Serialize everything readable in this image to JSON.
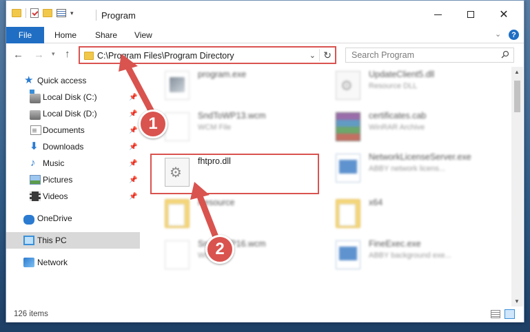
{
  "window": {
    "title": "Program"
  },
  "ribbon": {
    "tabs": [
      "File",
      "Home",
      "Share",
      "View"
    ]
  },
  "navbar": {
    "address": "C:\\Program Files\\Program Directory",
    "search_placeholder": "Search Program"
  },
  "sidebar": {
    "items": [
      {
        "label": "Quick access",
        "icon": "star-icon"
      },
      {
        "label": "Local Disk (C:)",
        "icon": "local-disk-icon",
        "pinned": true
      },
      {
        "label": "Local Disk (D:)",
        "icon": "local-disk-icon",
        "pinned": true
      },
      {
        "label": "Documents",
        "icon": "documents-icon",
        "pinned": true
      },
      {
        "label": "Downloads",
        "icon": "downloads-icon",
        "pinned": true
      },
      {
        "label": "Music",
        "icon": "music-icon",
        "pinned": true
      },
      {
        "label": "Pictures",
        "icon": "pictures-icon",
        "pinned": true
      },
      {
        "label": "Videos",
        "icon": "videos-icon",
        "pinned": true
      },
      {
        "label": "OneDrive",
        "icon": "onedrive-icon"
      },
      {
        "label": "This PC",
        "icon": "this-pc-icon",
        "selected": true
      },
      {
        "label": "Network",
        "icon": "network-icon"
      }
    ]
  },
  "files": [
    {
      "name": "program.exe",
      "desc": "",
      "icon": "exe-icon",
      "blurred": true
    },
    {
      "name": "UpdateClient5.dll",
      "desc": "Resource DLL",
      "icon": "dll-icon",
      "blurred": true
    },
    {
      "name": "SndToWP13.wcm",
      "desc": "WCM File",
      "icon": "wcm-file-icon",
      "blurred": true
    },
    {
      "name": "certificates.cab",
      "desc": "WinRAR Archive",
      "icon": "winrar-archive-icon",
      "blurred": true
    },
    {
      "name": "fhtpro.dll",
      "desc": "",
      "icon": "dll-icon",
      "blurred": false,
      "highlighted": true
    },
    {
      "name": "NetworkLicenseServer.exe",
      "desc": "ABBY network licens...",
      "icon": "exe-icon",
      "blurred": true
    },
    {
      "name": "Resource",
      "desc": "",
      "icon": "folder-icon",
      "blurred": true
    },
    {
      "name": "x64",
      "desc": "",
      "icon": "folder-icon",
      "blurred": true
    },
    {
      "name": "SndToWP16.wcm",
      "desc": "WCM File",
      "icon": "wcm-file-icon",
      "blurred": true
    },
    {
      "name": "FineExec.exe",
      "desc": "ABBY background exe...",
      "icon": "exe-icon",
      "blurred": true
    }
  ],
  "status": {
    "item_count": "126 items"
  },
  "annotations": {
    "badge_1": "1",
    "badge_2": "2",
    "accent_color": "#d9534f"
  }
}
